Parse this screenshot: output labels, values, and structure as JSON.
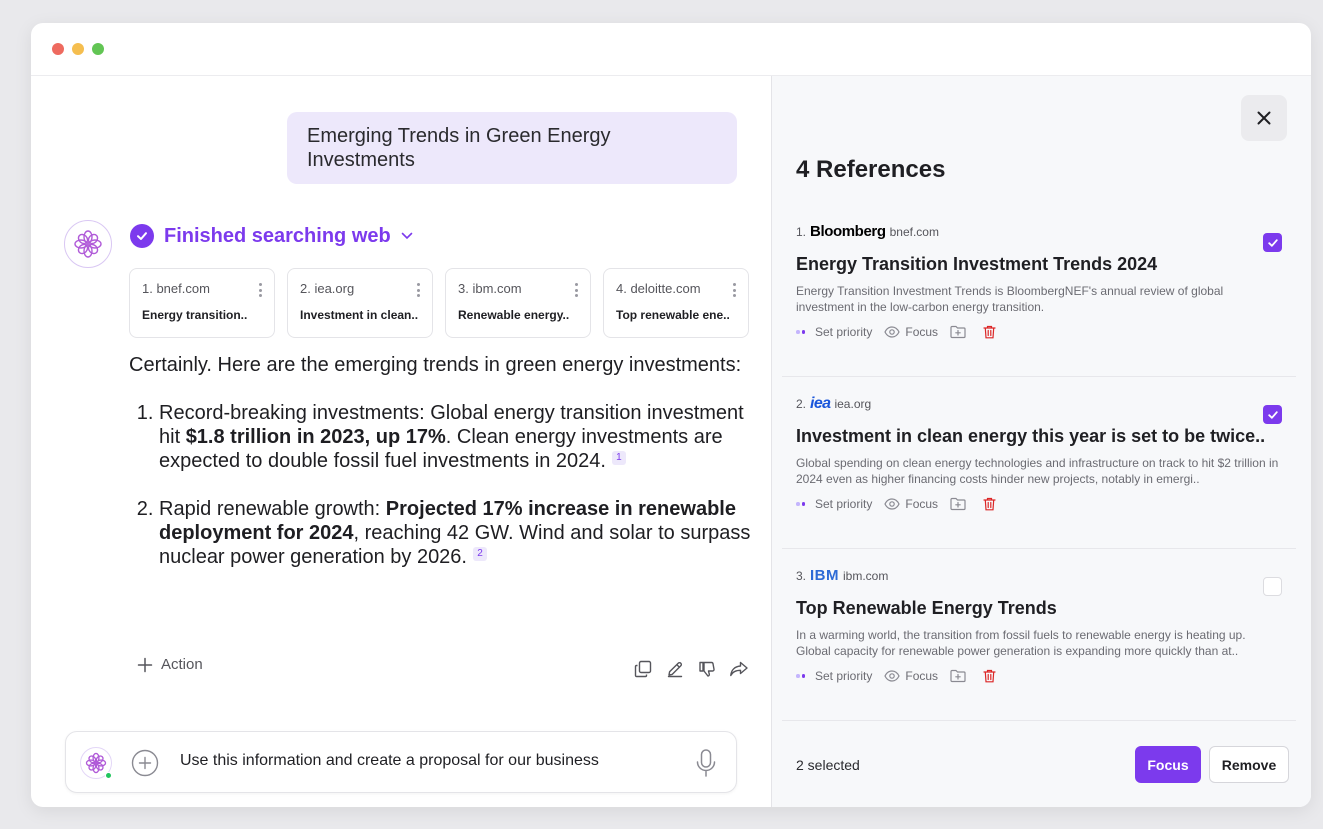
{
  "chat": {
    "user_message": "Emerging Trends in Green Energy Investments",
    "status": "Finished searching web",
    "sources": [
      {
        "domain": "1. bnef.com",
        "title": "Energy transition.."
      },
      {
        "domain": "2. iea.org",
        "title": "Investment in clean.."
      },
      {
        "domain": "3. ibm.com",
        "title": "Renewable energy.."
      },
      {
        "domain": "4. deloitte.com",
        "title": "Top renewable ene.."
      }
    ],
    "answer": {
      "intro": "Certainly. Here are the emerging trends in green energy investments:",
      "items": [
        {
          "pre": "Record-breaking investments: Global energy transition investment hit ",
          "bold": "$1.8 trillion in 2023, up 17%",
          "post": ". Clean energy investments are expected to double fossil fuel investments in 2024.",
          "cite": "1"
        },
        {
          "pre": "Rapid renewable growth: ",
          "bold": "Projected 17% increase in renewable deployment for 2024",
          "post": ", reaching 42 GW. Wind and solar to surpass nuclear power generation by 2026.",
          "cite": "2"
        }
      ]
    },
    "action_label": "Action",
    "composer_text": "Use this information and create a proposal for our business"
  },
  "panel": {
    "title": "4 References",
    "refs": [
      {
        "num": "1.",
        "logo": "Bloomberg",
        "site": "bnef.com",
        "title": "Energy Transition Investment Trends 2024",
        "desc": "Energy Transition Investment Trends is BloombergNEF's annual review of global investment in the low-carbon energy transition.",
        "checked": true
      },
      {
        "num": "2.",
        "logo": "iea",
        "site": "iea.org",
        "title": "Investment in clean energy this year is set to be twice..",
        "desc": "Global spending on clean energy technologies and infrastructure on track to hit $2 trillion in 2024 even as higher financing costs hinder new projects, notably in emergi..",
        "checked": true
      },
      {
        "num": "3.",
        "logo": "IBM",
        "site": "ibm.com",
        "title": "Top Renewable Energy Trends",
        "desc": "In a warming world, the transition from fossil fuels to renewable energy is heating up. Global capacity for renewable power generation is expanding more quickly than at..",
        "checked": false
      }
    ],
    "tools": {
      "priority": "Set priority",
      "focus": "Focus"
    },
    "footer": {
      "selected": "2 selected",
      "focus_button": "Focus",
      "remove_button": "Remove"
    }
  },
  "colors": {
    "accent": "#7c3aed",
    "user_bubble": "#ede8fb",
    "delete": "#dc2626"
  }
}
